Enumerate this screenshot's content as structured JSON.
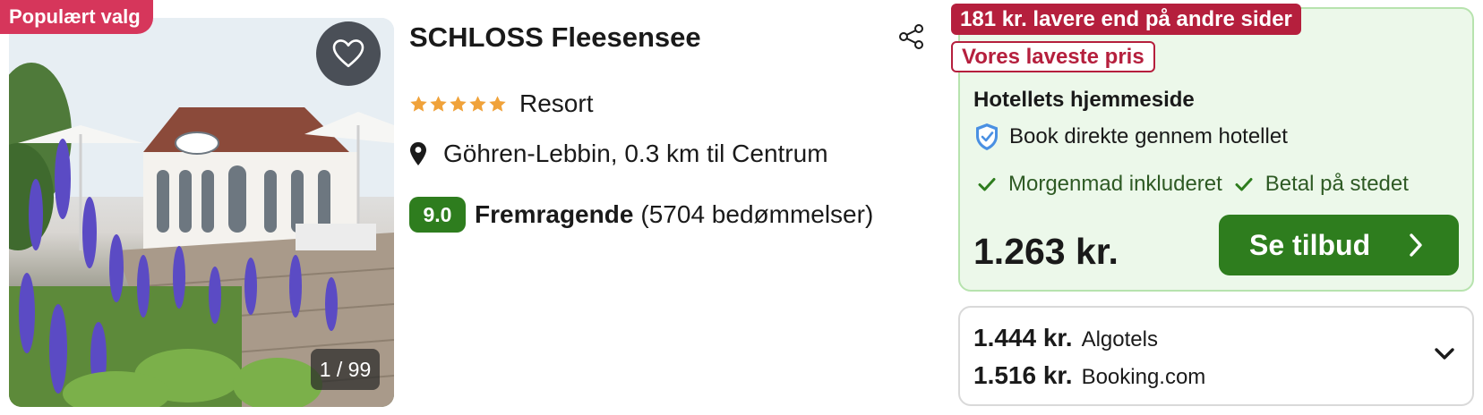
{
  "badges": {
    "popular": "Populært valg"
  },
  "photo": {
    "counter": "1 / 99"
  },
  "hotel": {
    "name": "SCHLOSS Fleesensee",
    "stars": 5,
    "type": "Resort",
    "location": "Göhren-Lebbin, 0.3 km til Centrum",
    "score": "9.0",
    "score_label": "Fremragende",
    "review_count": "(5704 bedømmelser)"
  },
  "deal": {
    "savings": "181 kr. lavere end på andre sider",
    "lowest": "Vores laveste pris",
    "provider": "Hotellets hjemmeside",
    "book_direct": "Book direkte gennem hotellet",
    "perks": [
      "Morgenmad inkluderet",
      "Betal på stedet"
    ],
    "price": "1.263 kr.",
    "cta": "Se tilbud"
  },
  "other_prices": [
    {
      "price": "1.444 kr.",
      "site": "Algotels"
    },
    {
      "price": "1.516 kr.",
      "site": "Booking.com"
    }
  ],
  "colors": {
    "popular_badge": "#d6365b",
    "savings_tag": "#b51f3d",
    "score_badge": "#2e7d1e",
    "cta_button": "#2e7d1e",
    "deal_background": "#ecf8ea",
    "star": "#f0a23a"
  },
  "icons": [
    "heart-icon",
    "share-icon",
    "star-icon",
    "map-pin-icon",
    "shield-check-icon",
    "checkmark-icon",
    "chevron-right-icon",
    "chevron-down-icon"
  ]
}
